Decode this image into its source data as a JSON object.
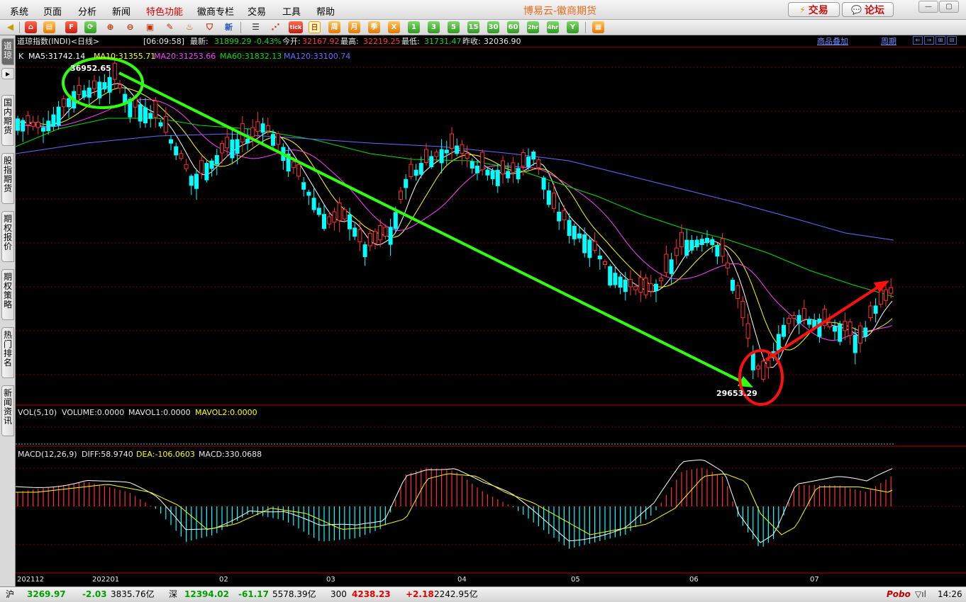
{
  "menubar": {
    "items": [
      "系统",
      "页面",
      "分析",
      "新闻",
      "特色功能",
      "徽商专栏",
      "交易",
      "工具",
      "帮助"
    ],
    "title": "博易云-徽商期货",
    "trade_button": "交易",
    "forum_button": "论坛"
  },
  "toolbar": {
    "period_buttons": [
      "tick",
      "日",
      "周",
      "月",
      "季",
      "X",
      "1",
      "3",
      "5",
      "15",
      "30",
      "60",
      "2hr",
      "4hr",
      "Y"
    ],
    "selected_period": "日",
    "new_label": "新"
  },
  "left_tabs": [
    "道琼",
    "国内期货",
    "股指期货",
    "期权报价",
    "期权策略",
    "热门排名",
    "新闻资讯"
  ],
  "header": {
    "instrument": "道琼指数(INDI)<日线>",
    "time": "[06:09:58]",
    "latest_label": "最新:",
    "latest": "31899.29",
    "change": "-0.43%",
    "open_label": "今开:",
    "open": "32167.92",
    "high_label": "最高:",
    "high": "32219.25",
    "low_label": "最低:",
    "low": "31731.47",
    "prev_close_label": "昨收:",
    "prev_close": "32036.90",
    "overlay_link": "商品叠加",
    "period_link": "周期"
  },
  "main_indicator": {
    "k": "K",
    "ma5": "MA5:31742.14",
    "ma10": "MA10:31355.71",
    "ma20": "MA20:31253.66",
    "ma60": "MA60:31832.13",
    "ma120": "MA120:33100.74"
  },
  "price_marks": {
    "high": "36952.65",
    "low": "29653.29"
  },
  "volume_indicator": {
    "title": "VOL(5,10)",
    "volume": "VOLUME:0.0000",
    "mavol1": "MAVOL1:0.0000",
    "mavol2": "MAVOL2:0.0000"
  },
  "macd_indicator": {
    "title": "MACD(12,26,9)",
    "diff": "DIFF:58.9740",
    "dea": "DEA:-106.0603",
    "macd": "MACD:330.0688"
  },
  "x_axis_labels": [
    "202112",
    "202201",
    "02",
    "03",
    "04",
    "05",
    "06",
    "07"
  ],
  "colors": {
    "up": "#ff3030",
    "down": "#00ffff",
    "ma5": "#ffffff",
    "ma10": "#ffff00",
    "ma20": "#ff40ff",
    "ma60": "#00e000",
    "ma120": "#6a6aff",
    "annotation_green": "#30ff10",
    "annotation_red": "#ff1010"
  },
  "status_bar": {
    "sh_label": "沪",
    "sh_value": "3269.97",
    "sh_change": "-2.03",
    "sh_amount": "3835.76亿",
    "sz_label": "深",
    "sz_value": "12394.02",
    "sz_change": "-61.17",
    "sz_amount": "5578.39亿",
    "hs300_label": "300",
    "hs300_value": "4238.23",
    "hs300_change": "+2.18",
    "hs300_amount": "2242.95亿",
    "brand": "Pobo",
    "clock": "14:26"
  }
}
